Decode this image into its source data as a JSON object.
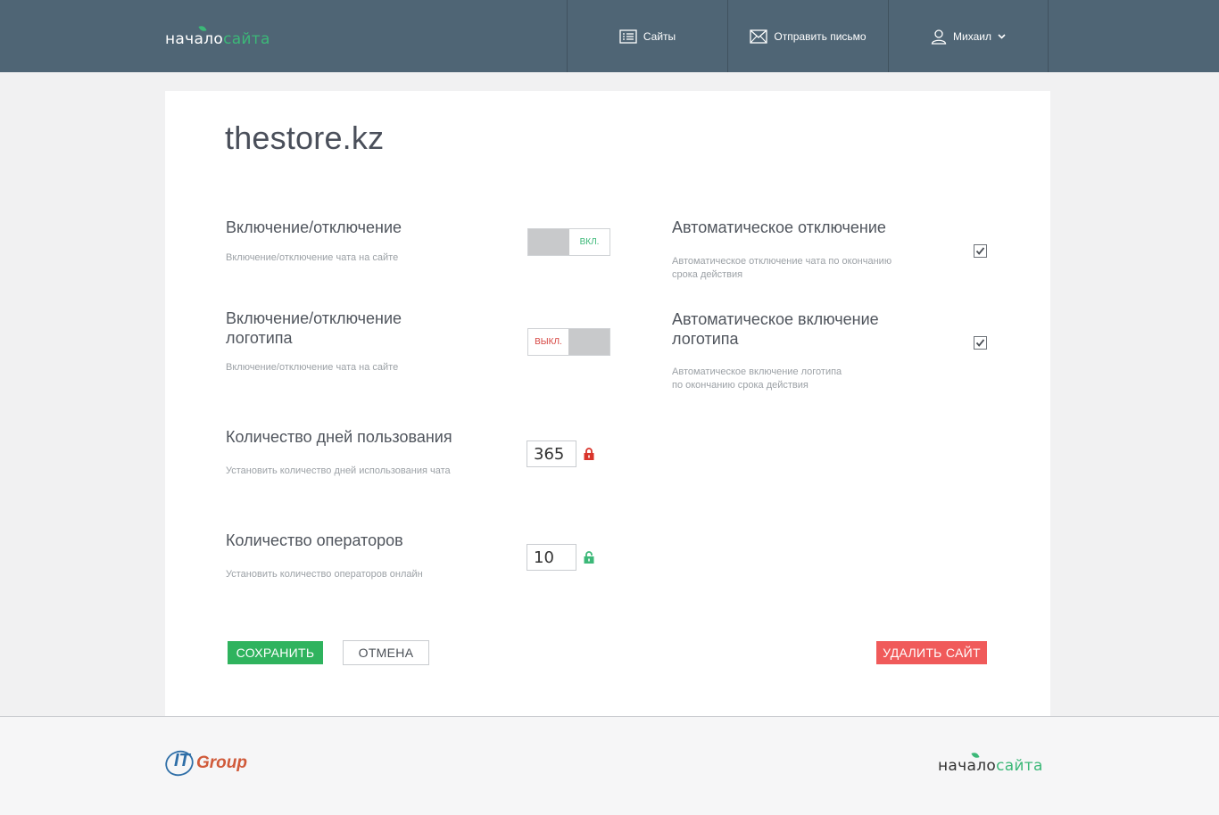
{
  "header": {
    "logo_part1": "начало",
    "logo_part2": "сайта",
    "nav": [
      {
        "label": "Сайты",
        "icon": "list-icon"
      },
      {
        "label": "Отправить письмо",
        "icon": "envelope-icon"
      },
      {
        "label": "Михаил",
        "icon": "user-icon"
      }
    ]
  },
  "page": {
    "site_title": "thestore.kz"
  },
  "settings": {
    "chat_toggle": {
      "title": "Включение/отключение",
      "desc": "Включение/отключение чата на сайте",
      "state_label": "ВКЛ.",
      "on": true
    },
    "logo_toggle": {
      "title_line1": "Включение/отключение",
      "title_line2": "логотипа",
      "desc": "Включение/отключение чата на сайте",
      "state_label": "ВЫКЛ.",
      "on": false
    },
    "days": {
      "title": "Количество дней пользования",
      "desc": "Установить количество дней использования чата",
      "value": "365",
      "locked": true
    },
    "operators": {
      "title": "Количество операторов",
      "desc": "Установить количество операторов онлайн",
      "value": "10",
      "locked": false
    },
    "auto_off": {
      "title": "Автоматическое отключение",
      "desc_line1": "Автоматическое отключение чата по окончанию",
      "desc_line2": "срока действия",
      "checked": true
    },
    "auto_logo": {
      "title_line1": "Автоматическое включение",
      "title_line2": "логотипа",
      "desc_line1": "Автоматическое включение логотипа",
      "desc_line2": "по окончанию срока действия",
      "checked": true
    }
  },
  "actions": {
    "save": "СОХРАНИТЬ",
    "cancel": "ОТМЕНА",
    "delete": "УДАЛИТЬ САЙТ"
  },
  "footer": {
    "partner_logo_it": "IT",
    "partner_logo_group": "Group",
    "logo_part1": "начало",
    "logo_part2": "сайта"
  },
  "colors": {
    "header_bg": "#4f6575",
    "accent_green": "#2fb35e",
    "danger_red": "#f05a5a",
    "lock_red": "#d9342b",
    "lock_green": "#3cb878"
  }
}
